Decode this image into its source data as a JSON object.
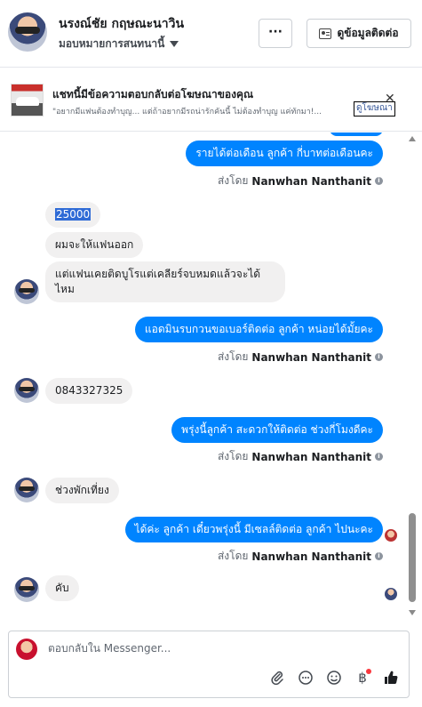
{
  "header": {
    "name": "นรงณ์ชัย กฤษณะนาวิน",
    "assign_label": "มอบหมายการสนทนานี้",
    "more_label": "···",
    "contact_label": "ดูข้อมูลติดต่อ"
  },
  "ad": {
    "title": "แชทนี้มีข้อความตอบกลับต่อโฆษณาของคุณ",
    "text": "\"อยากมีแฟนต้องทำบุญ... แต่ถ้าอยากมีรถน่ารักคันนี้ ไม่ต้องทำบุญ แค่ทักมา!...",
    "link_label": "ดูโฆษณา",
    "close_label": "✕"
  },
  "messages": [
    {
      "side": "out",
      "text": "รายได้ต่อเดือน ลูกค้า กี่บาทต่อเดือนคะ"
    },
    {
      "side": "in",
      "text": "25000"
    },
    {
      "side": "in",
      "text": "ผมจะให้แฟนออก"
    },
    {
      "side": "in",
      "text": "แต่แฟนเคยติดบูโรแต่เคลียร์จบหมดแล้วจะได้"
    },
    {
      "side": "in",
      "text": "ไหม"
    },
    {
      "side": "out",
      "text": "แอดมินรบกวนขอเบอร์ติดต่อ ลูกค้า หน่อยได้มั้ยคะ"
    },
    {
      "side": "in",
      "text": "0843327325"
    },
    {
      "side": "out",
      "text": "พรุ่งนี้ลูกค้า สะดวกให้ติดต่อ ช่วงกี่โมงดีคะ"
    },
    {
      "side": "in",
      "text": "ช่วงพักเที่ยง"
    },
    {
      "side": "out",
      "text": "ได้ค่ะ  ลูกค้า เดี๋ยวพรุ่งนี้ มีเซลล์ติดต่อ ลูกค้า ไปนะคะ"
    },
    {
      "side": "in",
      "text": "คับ"
    }
  ],
  "sent_by": {
    "prefix": "ส่งโดย",
    "sender": "Nanwhan Nanthanit",
    "info": "i"
  },
  "composer": {
    "placeholder": "ตอบกลับใน Messenger...",
    "tools": [
      "paperclip-icon",
      "chat-bubble-icon",
      "smiley-icon",
      "baht-icon",
      "thumbs-up-icon"
    ],
    "baht_label": "฿"
  }
}
